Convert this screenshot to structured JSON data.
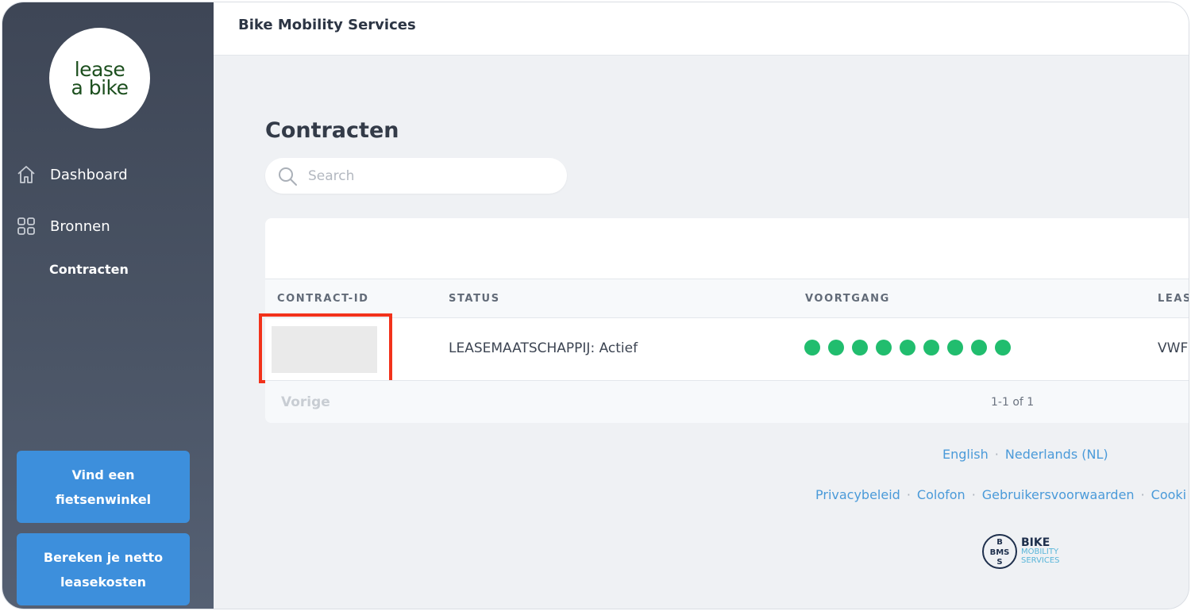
{
  "app": {
    "topbar_title": "Bike Mobility Services",
    "logo_line1": "lease",
    "logo_line2": "a bike"
  },
  "sidebar": {
    "items": [
      {
        "label": "Dashboard",
        "icon": "home-icon"
      },
      {
        "label": "Bronnen",
        "icon": "grid-icon"
      }
    ],
    "sub_item": "Contracten",
    "buttons": [
      {
        "label_line1": "Vind een",
        "label_line2": "fietsenwinkel"
      },
      {
        "label_line1": "Bereken je netto",
        "label_line2": "leasekosten"
      }
    ]
  },
  "main": {
    "page_title": "Contracten",
    "search": {
      "placeholder": "Search",
      "value": ""
    },
    "table": {
      "columns": [
        "CONTRACT-ID",
        "STATUS",
        "VOORTGANG",
        "LEAS"
      ],
      "rows": [
        {
          "contract_id": "",
          "status": "LEASEMAATSCHAPPIJ: Actief",
          "progress_steps_completed": 9,
          "progress_steps_total": 9,
          "lease": "VWF"
        }
      ],
      "footer": {
        "prev_label": "Vorige",
        "count": "1-1 of 1"
      }
    }
  },
  "footer": {
    "languages": [
      "English",
      "Nederlands (NL)"
    ],
    "links": [
      "Privacybeleid",
      "Colofon",
      "Gebruikersvoorwaarden",
      "Cooki"
    ],
    "bms_logo": {
      "initials_top": "B",
      "initials_mid": "BMS",
      "initials_bottom": "S",
      "line1": "BIKE",
      "line2": "MOBILITY",
      "line3": "SERVICES"
    }
  },
  "colors": {
    "accent": "#3d8fdc",
    "status_green": "#21bd6e",
    "highlight_red": "#f2321b",
    "link": "#4a9ad9"
  }
}
